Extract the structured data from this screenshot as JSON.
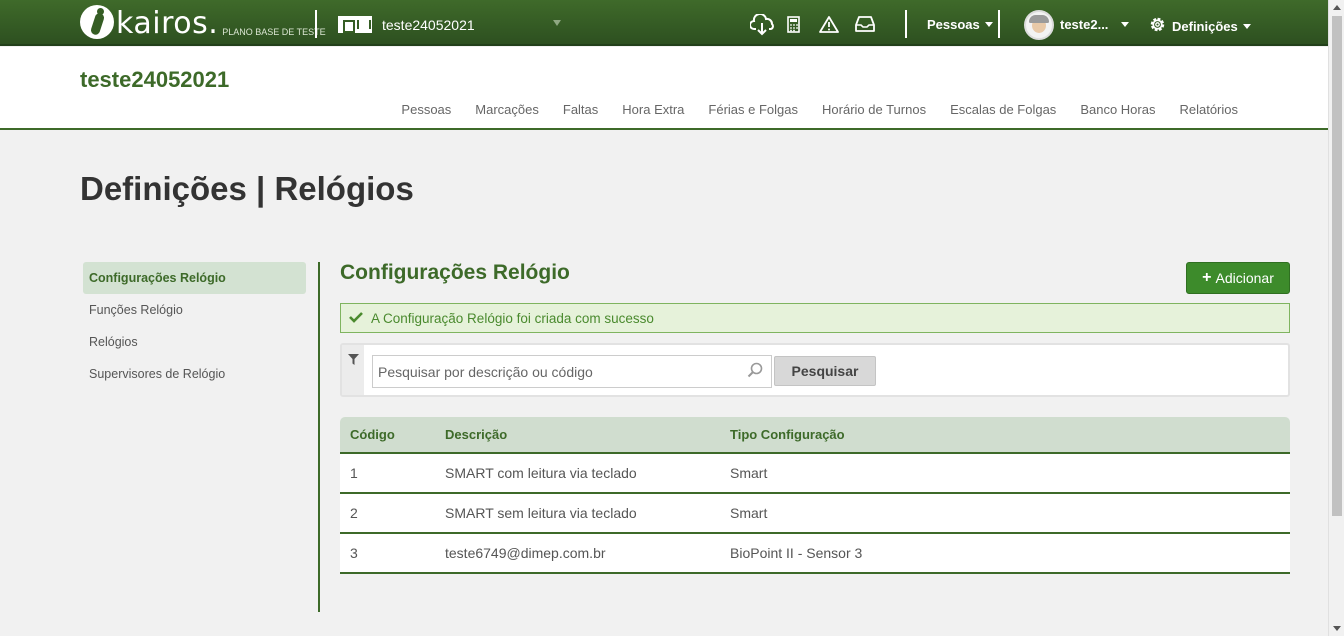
{
  "topbar": {
    "logo_text": "kairos.",
    "logo_sub": "PLANO BASE DE TESTE",
    "company": "teste24052021",
    "people_menu": "Pessoas",
    "user_name": "teste2...",
    "settings_menu": "Definições",
    "icons": [
      "cloud-download-icon",
      "calculator-icon",
      "warning-icon",
      "inbox-icon"
    ]
  },
  "header": {
    "company_title": "teste24052021",
    "nav": [
      "Pessoas",
      "Marcações",
      "Faltas",
      "Hora Extra",
      "Férias e Folgas",
      "Horário de Turnos",
      "Escalas de Folgas",
      "Banco Horas",
      "Relatórios"
    ]
  },
  "page": {
    "title": "Definições | Relógios"
  },
  "sidebar": {
    "items": [
      {
        "label": "Configurações Relógio",
        "active": true
      },
      {
        "label": "Funções Relógio",
        "active": false
      },
      {
        "label": "Relógios",
        "active": false
      },
      {
        "label": "Supervisores de Relógio",
        "active": false
      }
    ]
  },
  "content": {
    "title": "Configurações Relógio",
    "add_button": "Adicionar",
    "alert": "A Configuração Relógio foi criada com sucesso",
    "search": {
      "placeholder": "Pesquisar por descrição ou código",
      "value": "",
      "button": "Pesquisar"
    },
    "table": {
      "headers": [
        "Código",
        "Descrição",
        "Tipo Configuração"
      ],
      "rows": [
        [
          "1",
          "SMART com leitura via teclado",
          "Smart"
        ],
        [
          "2",
          "SMART sem leitura via teclado",
          "Smart"
        ],
        [
          "3",
          "teste6749@dimep.com.br",
          "BioPoint II - Sensor 3"
        ]
      ]
    }
  },
  "colors": {
    "primary": "#3d6a29",
    "button": "#3d8b2b",
    "alert_bg": "#e6f2da"
  }
}
